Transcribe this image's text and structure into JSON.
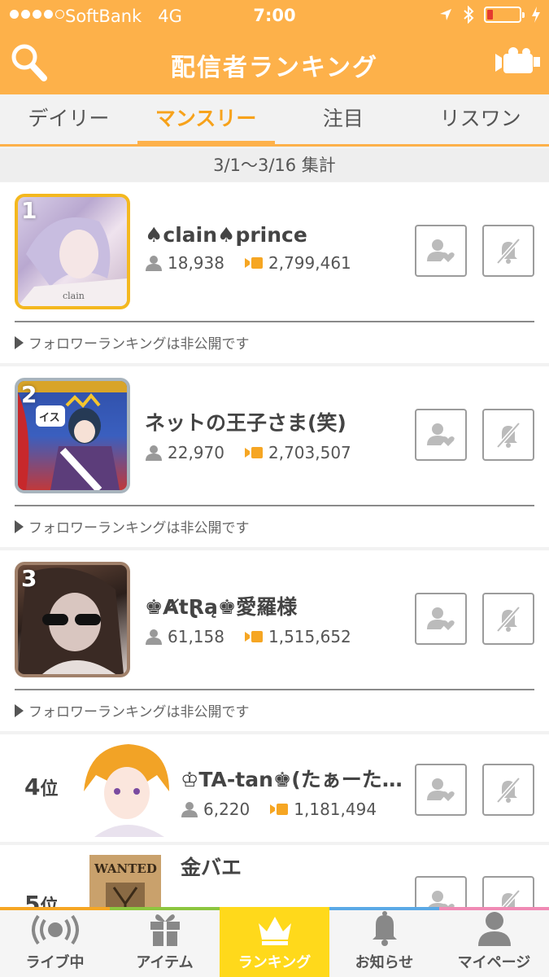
{
  "status": {
    "carrier": "SoftBank",
    "network": "4G",
    "time": "7:00"
  },
  "header": {
    "title": "配信者ランキング"
  },
  "tabs": [
    {
      "label": "デイリー",
      "active": false
    },
    {
      "label": "マンスリー",
      "active": true
    },
    {
      "label": "注目",
      "active": false
    },
    {
      "label": "リスワン",
      "active": false
    }
  ],
  "period": "3/1〜3/16 集計",
  "ranking": [
    {
      "rank": "1",
      "name": "♠clain♠prince",
      "listeners": "18,938",
      "points": "2,799,461",
      "note": "フォロワーランキングは非公開です",
      "thumb_caption": "clain"
    },
    {
      "rank": "2",
      "name": "ネットの王子さま(笑)",
      "listeners": "22,970",
      "points": "2,703,507",
      "note": "フォロワーランキングは非公開です",
      "thumb_caption": "イス"
    },
    {
      "rank": "3",
      "name": "♚ȺtⱤą♚愛羅様",
      "listeners": "61,158",
      "points": "1,515,652",
      "note": "フォロワーランキングは非公開です"
    },
    {
      "rank": "4",
      "rank_suffix": "位",
      "name": "♔TA-tan♚(たぁーた…",
      "listeners": "6,220",
      "points": "1,181,494"
    },
    {
      "rank": "5",
      "rank_suffix": "位",
      "name": "金バエ",
      "thumb_caption": "WANTED"
    }
  ],
  "tabbar": [
    {
      "label": "ライブ中",
      "icon": "live-icon",
      "active": false
    },
    {
      "label": "アイテム",
      "icon": "gift-icon",
      "active": false
    },
    {
      "label": "ランキング",
      "icon": "crown-icon",
      "active": true
    },
    {
      "label": "お知らせ",
      "icon": "bell-icon",
      "active": false
    },
    {
      "label": "マイページ",
      "icon": "person-icon",
      "active": false
    }
  ],
  "colors": {
    "brand": "#fdb14a",
    "active_tab": "#ffd91b",
    "gold_frame": "#f4b81f",
    "silver_frame": "#a8b4bd",
    "bronze_frame": "#a0806a"
  }
}
